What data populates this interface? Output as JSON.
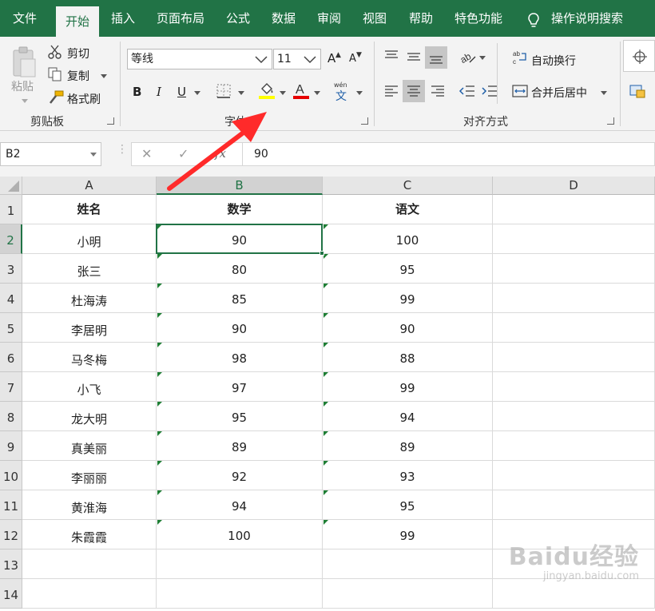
{
  "ribbon_tabs": [
    "文件",
    "开始",
    "插入",
    "页面布局",
    "公式",
    "数据",
    "审阅",
    "视图",
    "帮助",
    "特色功能"
  ],
  "active_tab": "开始",
  "tell_me": "操作说明搜索",
  "clipboard": {
    "paste": "粘贴",
    "cut": "剪切",
    "copy": "复制",
    "format_painter": "格式刷",
    "group_label": "剪贴板"
  },
  "font": {
    "font_name": "等线",
    "font_size": "11",
    "bold": "B",
    "italic": "I",
    "underline": "U",
    "grow": "A",
    "shrink": "A",
    "phonetic_top": "wén",
    "phonetic_bottom": "文",
    "group_label": "字体",
    "fill_color": "#ffff00",
    "font_color": "#e60000"
  },
  "alignment": {
    "wrap_text": "自动换行",
    "merge_center": "合并后居中",
    "group_label": "对齐方式"
  },
  "formula_bar": {
    "name_box": "B2",
    "cancel": "✕",
    "enter": "✓",
    "fx": "fx",
    "value": "90"
  },
  "columns": [
    "A",
    "B",
    "C",
    "D"
  ],
  "selected_column": "B",
  "rows": [
    "1",
    "2",
    "3",
    "4",
    "5",
    "6",
    "7",
    "8",
    "9",
    "10",
    "11",
    "12",
    "13",
    "14"
  ],
  "selected_row": "2",
  "active_cell": "B2",
  "table": {
    "headers": [
      "姓名",
      "数学",
      "语文"
    ],
    "data": [
      [
        "小明",
        "90",
        "100"
      ],
      [
        "张三",
        "80",
        "95"
      ],
      [
        "杜海涛",
        "85",
        "99"
      ],
      [
        "李居明",
        "90",
        "90"
      ],
      [
        "马冬梅",
        "98",
        "88"
      ],
      [
        "小飞",
        "97",
        "99"
      ],
      [
        "龙大明",
        "95",
        "94"
      ],
      [
        "真美丽",
        "89",
        "89"
      ],
      [
        "李丽丽",
        "92",
        "93"
      ],
      [
        "黄淮海",
        "94",
        "95"
      ],
      [
        "朱霞霞",
        "100",
        "99"
      ]
    ]
  },
  "accent_color": "#217346",
  "annotation_arrow_color": "#ff2a2a",
  "watermark": {
    "logo": "Baidu经验",
    "url": "jingyan.baidu.com"
  }
}
